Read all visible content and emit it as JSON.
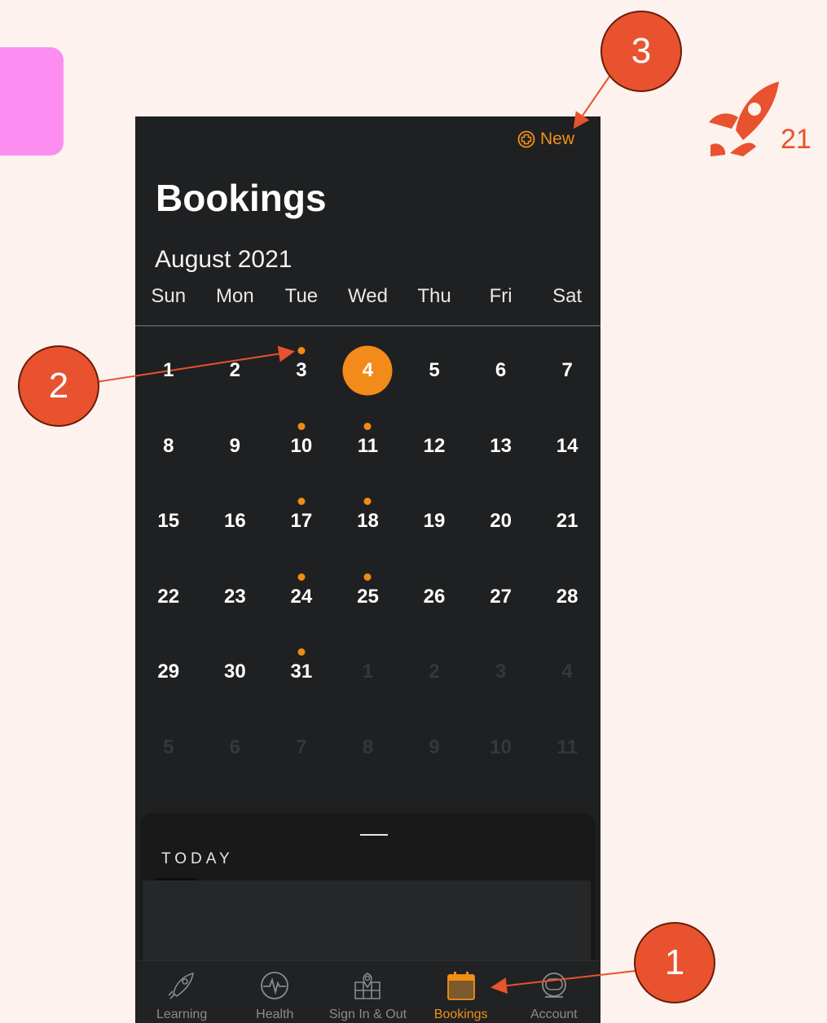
{
  "brand": {
    "number": "21",
    "color": "#e8522e"
  },
  "screen": {
    "new_button": {
      "icon": "plus-circle-icon",
      "label": "New"
    },
    "title": "Bookings",
    "month": "August 2021",
    "weekdays": [
      "Sun",
      "Mon",
      "Tue",
      "Wed",
      "Thu",
      "Fri",
      "Sat"
    ],
    "weeks": [
      [
        {
          "d": "1"
        },
        {
          "d": "2"
        },
        {
          "d": "3",
          "dot": true
        },
        {
          "d": "4",
          "today": true
        },
        {
          "d": "5"
        },
        {
          "d": "6"
        },
        {
          "d": "7"
        }
      ],
      [
        {
          "d": "8"
        },
        {
          "d": "9"
        },
        {
          "d": "10",
          "dot": true
        },
        {
          "d": "11",
          "dot": true
        },
        {
          "d": "12"
        },
        {
          "d": "13"
        },
        {
          "d": "14"
        }
      ],
      [
        {
          "d": "15"
        },
        {
          "d": "16"
        },
        {
          "d": "17",
          "dot": true
        },
        {
          "d": "18",
          "dot": true
        },
        {
          "d": "19"
        },
        {
          "d": "20"
        },
        {
          "d": "21"
        }
      ],
      [
        {
          "d": "22"
        },
        {
          "d": "23"
        },
        {
          "d": "24",
          "dot": true
        },
        {
          "d": "25",
          "dot": true
        },
        {
          "d": "26"
        },
        {
          "d": "27"
        },
        {
          "d": "28"
        }
      ],
      [
        {
          "d": "29"
        },
        {
          "d": "30"
        },
        {
          "d": "31",
          "dot": true
        },
        {
          "d": "1",
          "dim": true
        },
        {
          "d": "2",
          "dim": true
        },
        {
          "d": "3",
          "dim": true
        },
        {
          "d": "4",
          "dim": true
        }
      ],
      [
        {
          "d": "5",
          "dim": true
        },
        {
          "d": "6",
          "dim": true
        },
        {
          "d": "7",
          "dim": true
        },
        {
          "d": "8",
          "dim": true
        },
        {
          "d": "9",
          "dim": true
        },
        {
          "d": "10",
          "dim": true
        },
        {
          "d": "11",
          "dim": true
        }
      ]
    ],
    "sheet": {
      "section_label": "TODAY"
    },
    "accent_color": "#f38b1a"
  },
  "tabbar": {
    "tabs": [
      {
        "label": "Learning",
        "icon": "rocket-icon",
        "active": false
      },
      {
        "label": "Health",
        "icon": "heartbeat-icon",
        "active": false
      },
      {
        "label": "Sign In & Out",
        "icon": "map-pin-icon",
        "active": false
      },
      {
        "label": "Bookings",
        "icon": "calendar-icon",
        "active": true
      },
      {
        "label": "Account",
        "icon": "astronaut-helmet-icon",
        "active": false
      }
    ]
  },
  "callouts": [
    {
      "label": "1"
    },
    {
      "label": "2"
    },
    {
      "label": "3"
    }
  ]
}
